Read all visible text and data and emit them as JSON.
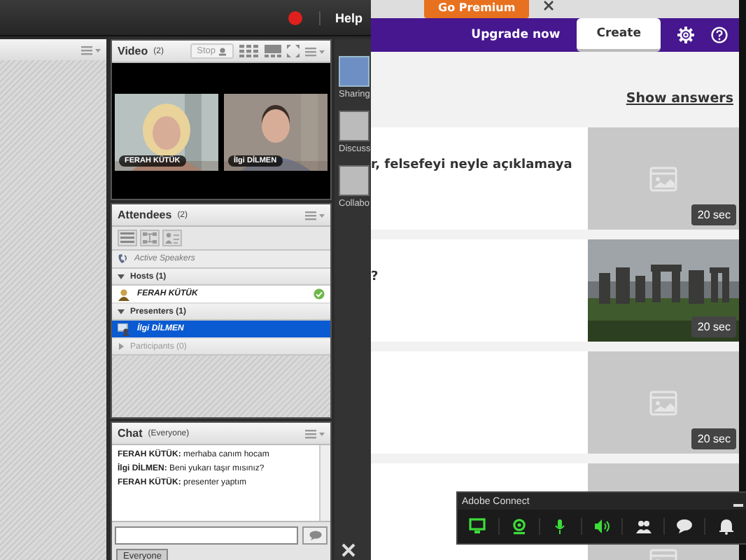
{
  "app_bar": {
    "help": "Help"
  },
  "video_pod": {
    "title": "Video",
    "count": "(2)",
    "stop": "Stop",
    "tiles": [
      {
        "name": "FERAH KÜTÜK",
        "kind": "picture"
      },
      {
        "name": "İlgi DİLMEN",
        "kind": "picture"
      }
    ]
  },
  "attendees_pod": {
    "title": "Attendees",
    "count": "(2)",
    "active_speakers": "Active Speakers",
    "groups": [
      {
        "label": "Hosts (1)",
        "expanded": true,
        "children": [
          {
            "name": "FERAH KÜTÜK",
            "kind": "host",
            "selected": false,
            "ready": true
          }
        ]
      },
      {
        "label": "Presenters (1)",
        "expanded": true,
        "children": [
          {
            "name": "İlgi DİLMEN",
            "kind": "presenter",
            "selected": true,
            "ready": false
          }
        ]
      },
      {
        "label": "Participants (0)",
        "expanded": false,
        "disabled": true
      }
    ]
  },
  "chat_pod": {
    "title": "Chat",
    "audience": "(Everyone)",
    "messages": [
      {
        "sender": "FERAH KÜTÜK:",
        "text": "merhaba canım hocam"
      },
      {
        "sender": "İlgi DİLMEN:",
        "text": "Beni yukarı taşır mısınız?"
      },
      {
        "sender": "FERAH KÜTÜK:",
        "text": "presenter yaptım"
      }
    ],
    "tab": "Everyone"
  },
  "layouts": [
    {
      "label": "Sharing",
      "selected": true
    },
    {
      "label": "Discuss",
      "selected": false
    },
    {
      "label": "Collabo",
      "selected": false
    }
  ],
  "browser": {
    "promo": "Go Premium",
    "upgrade": "Upgrade now",
    "create": "Create",
    "show_answers": "Show answers",
    "questions": [
      {
        "text": "r, felsefeyi neyle açıklamaya",
        "kind": "placeholder",
        "duration": "20 sec"
      },
      {
        "text": "?",
        "duration": "20 sec"
      },
      {
        "kind": "placeholder",
        "duration": "20 sec"
      },
      {
        "kind": "placeholder"
      }
    ]
  },
  "connect_bar": {
    "title": "Adobe Connect",
    "buttons": [
      {
        "kind": "screen",
        "active": true
      },
      {
        "kind": "webcam",
        "active": true
      },
      {
        "kind": "mic",
        "active": true
      },
      {
        "kind": "speaker",
        "active": true
      },
      {
        "kind": "people",
        "active": false
      },
      {
        "kind": "chat",
        "active": false
      },
      {
        "kind": "bell",
        "active": false
      }
    ]
  }
}
